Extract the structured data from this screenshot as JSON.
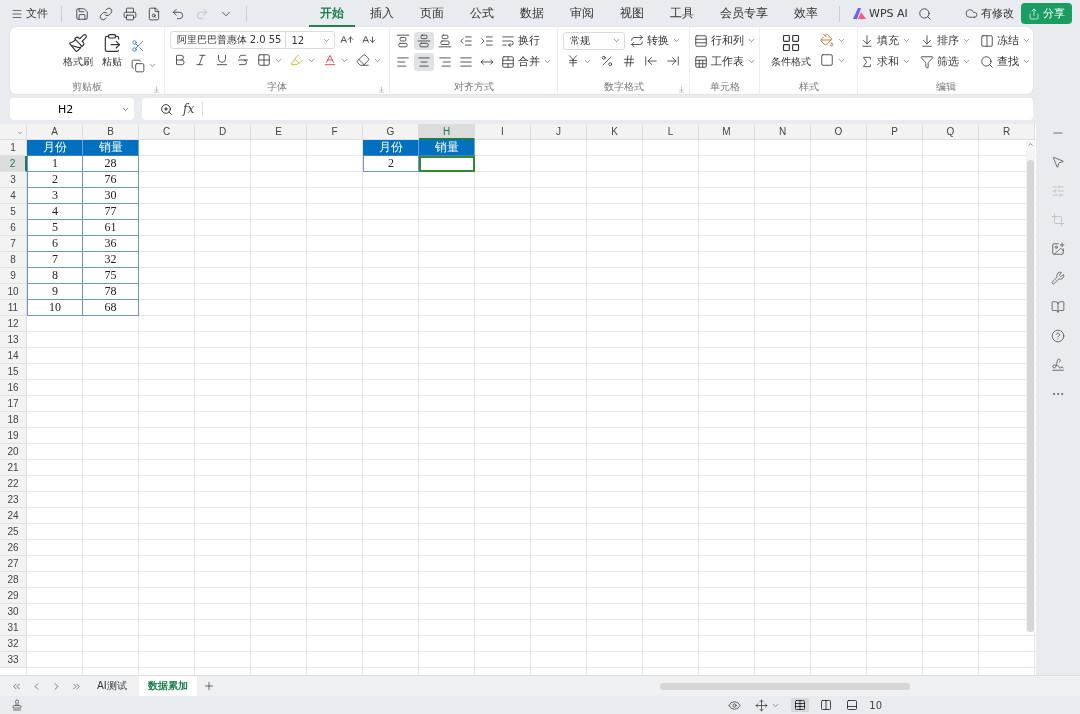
{
  "top_bar": {
    "menu_label": "文件",
    "tabs": [
      {
        "label": "开始",
        "selected": true
      },
      {
        "label": "插入",
        "selected": false
      },
      {
        "label": "页面",
        "selected": false
      },
      {
        "label": "公式",
        "selected": false
      },
      {
        "label": "数据",
        "selected": false
      },
      {
        "label": "审阅",
        "selected": false
      },
      {
        "label": "视图",
        "selected": false
      },
      {
        "label": "工具",
        "selected": false
      },
      {
        "label": "会员专享",
        "selected": false
      },
      {
        "label": "效率",
        "selected": false
      }
    ],
    "ai_label": "WPS AI",
    "save_status": "有修改",
    "share_label": "分享"
  },
  "ribbon": {
    "clipboard": {
      "title": "剪贴板",
      "format_painter": "格式刷",
      "paste": "粘贴"
    },
    "font": {
      "title": "字体",
      "font_name": "阿里巴巴普惠体 2.0 55",
      "font_size": "12"
    },
    "alignment": {
      "title": "对齐方式",
      "wrap": "换行",
      "merge": "合并",
      "top_row": [
        {
          "selected": false
        },
        {
          "selected": true
        },
        {
          "selected": false
        },
        {
          "selected": false
        },
        {
          "selected": false
        }
      ],
      "bottom_row": [
        {
          "selected": false
        },
        {
          "selected": true
        },
        {
          "selected": false
        },
        {
          "selected": false
        },
        {
          "selected": false
        }
      ]
    },
    "number": {
      "title": "数字格式",
      "format": "常规",
      "convert": "转换"
    },
    "cells": {
      "title": "单元格",
      "rows_cols": "行和列",
      "worksheet": "工作表"
    },
    "styles": {
      "title": "样式",
      "conditional": "条件格式"
    },
    "editing": {
      "title": "编辑",
      "fill": "填充",
      "sort": "排序",
      "freeze": "冻结",
      "sum": "求和",
      "filter": "筛选",
      "find": "查找"
    }
  },
  "formula_bar": {
    "name_box": "H2",
    "fx": "fx"
  },
  "sheet": {
    "columns": [
      {
        "label": "A",
        "selected": false
      },
      {
        "label": "B",
        "selected": false
      },
      {
        "label": "C",
        "selected": false
      },
      {
        "label": "D",
        "selected": false
      },
      {
        "label": "E",
        "selected": false
      },
      {
        "label": "F",
        "selected": false
      },
      {
        "label": "G",
        "selected": false
      },
      {
        "label": "H",
        "selected": true
      },
      {
        "label": "I",
        "selected": false
      },
      {
        "label": "J",
        "selected": false
      },
      {
        "label": "K",
        "selected": false
      },
      {
        "label": "L",
        "selected": false
      },
      {
        "label": "M",
        "selected": false
      },
      {
        "label": "N",
        "selected": false
      },
      {
        "label": "O",
        "selected": false
      },
      {
        "label": "P",
        "selected": false
      },
      {
        "label": "Q",
        "selected": false
      },
      {
        "label": "R",
        "selected": false
      }
    ],
    "rows": [
      {
        "label": "1",
        "selected": false
      },
      {
        "label": "2",
        "selected": true
      },
      {
        "label": "3",
        "selected": false
      },
      {
        "label": "4",
        "selected": false
      },
      {
        "label": "5",
        "selected": false
      },
      {
        "label": "6",
        "selected": false
      },
      {
        "label": "7",
        "selected": false
      },
      {
        "label": "8",
        "selected": false
      },
      {
        "label": "9",
        "selected": false
      },
      {
        "label": "10",
        "selected": false
      },
      {
        "label": "11",
        "selected": false
      },
      {
        "label": "12",
        "selected": false
      },
      {
        "label": "13",
        "selected": false
      },
      {
        "label": "14",
        "selected": false
      },
      {
        "label": "15",
        "selected": false
      },
      {
        "label": "16",
        "selected": false
      },
      {
        "label": "17",
        "selected": false
      },
      {
        "label": "18",
        "selected": false
      },
      {
        "label": "19",
        "selected": false
      },
      {
        "label": "20",
        "selected": false
      },
      {
        "label": "21",
        "selected": false
      },
      {
        "label": "22",
        "selected": false
      },
      {
        "label": "23",
        "selected": false
      },
      {
        "label": "24",
        "selected": false
      },
      {
        "label": "25",
        "selected": false
      },
      {
        "label": "26",
        "selected": false
      },
      {
        "label": "27",
        "selected": false
      },
      {
        "label": "28",
        "selected": false
      },
      {
        "label": "29",
        "selected": false
      },
      {
        "label": "30",
        "selected": false
      },
      {
        "label": "31",
        "selected": false
      },
      {
        "label": "32",
        "selected": false
      },
      {
        "label": "33",
        "selected": false
      }
    ],
    "left_table": {
      "headers": [
        "月份",
        "销量"
      ],
      "rows": [
        [
          "1",
          "28"
        ],
        [
          "2",
          "76"
        ],
        [
          "3",
          "30"
        ],
        [
          "4",
          "77"
        ],
        [
          "5",
          "61"
        ],
        [
          "6",
          "36"
        ],
        [
          "7",
          "32"
        ],
        [
          "8",
          "75"
        ],
        [
          "9",
          "78"
        ],
        [
          "10",
          "68"
        ]
      ]
    },
    "right_table": {
      "headers": [
        "月份",
        "销量"
      ],
      "rows": [
        [
          "2"
        ]
      ]
    }
  },
  "sheet_tabs": [
    {
      "label": "AI测试",
      "selected": false
    },
    {
      "label": "数据累加",
      "selected": true
    }
  ],
  "status_bar": {
    "views": [
      {
        "selected": true
      },
      {
        "selected": false
      },
      {
        "selected": false
      }
    ],
    "zoom": "10"
  }
}
